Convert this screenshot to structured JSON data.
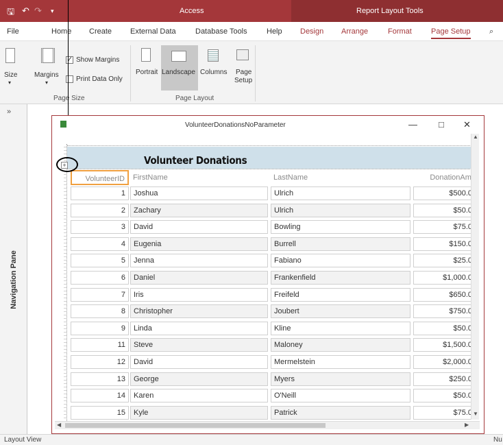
{
  "titlebar": {
    "app_title": "Access",
    "context_title": "Report Layout Tools"
  },
  "tabs": [
    {
      "label": "File",
      "context": false,
      "active": false
    },
    {
      "label": "Home",
      "context": false,
      "active": false
    },
    {
      "label": "Create",
      "context": false,
      "active": false
    },
    {
      "label": "External Data",
      "context": false,
      "active": false
    },
    {
      "label": "Database Tools",
      "context": false,
      "active": false
    },
    {
      "label": "Help",
      "context": false,
      "active": false
    },
    {
      "label": "Design",
      "context": true,
      "active": false
    },
    {
      "label": "Arrange",
      "context": true,
      "active": false
    },
    {
      "label": "Format",
      "context": true,
      "active": false
    },
    {
      "label": "Page Setup",
      "context": true,
      "active": true
    }
  ],
  "ribbon": {
    "size_label": "Size",
    "margins_label": "Margins",
    "show_margins_label": "Show Margins",
    "show_margins_checked": true,
    "print_data_only_label": "Print Data Only",
    "print_data_only_checked": false,
    "page_size_group": "Page Size",
    "portrait_label": "Portrait",
    "landscape_label": "Landscape",
    "columns_label": "Columns",
    "page_setup_label_1": "Page",
    "page_setup_label_2": "Setup",
    "page_layout_group": "Page Layout"
  },
  "nav_pane": {
    "chevron": "»",
    "label": "Navigation Pane"
  },
  "document": {
    "caption": "VolunteerDonationsNoParameter",
    "report_title": "Volunteer Donations",
    "columns": [
      "VolunteerID",
      "FirstName",
      "LastName",
      "DonationAmo"
    ],
    "rows": [
      {
        "id": "1",
        "first": "Joshua",
        "last": "Ulrich",
        "amount": "$500.0"
      },
      {
        "id": "2",
        "first": "Zachary",
        "last": "Ulrich",
        "amount": "$50.0"
      },
      {
        "id": "3",
        "first": "David",
        "last": "Bowling",
        "amount": "$75.0"
      },
      {
        "id": "4",
        "first": "Eugenia",
        "last": "Burrell",
        "amount": "$150.0"
      },
      {
        "id": "5",
        "first": "Jenna",
        "last": "Fabiano",
        "amount": "$25.0"
      },
      {
        "id": "6",
        "first": "Daniel",
        "last": "Frankenfield",
        "amount": "$1,000.0"
      },
      {
        "id": "7",
        "first": "Iris",
        "last": "Freifeld",
        "amount": "$650.0"
      },
      {
        "id": "8",
        "first": "Christopher",
        "last": "Joubert",
        "amount": "$750.0"
      },
      {
        "id": "9",
        "first": "Linda",
        "last": "Kline",
        "amount": "$50.0"
      },
      {
        "id": "11",
        "first": "Steve",
        "last": "Maloney",
        "amount": "$1,500.0"
      },
      {
        "id": "12",
        "first": "David",
        "last": "Mermelstein",
        "amount": "$2,000.0"
      },
      {
        "id": "13",
        "first": "George",
        "last": "Myers",
        "amount": "$250.0"
      },
      {
        "id": "14",
        "first": "Karen",
        "last": "O'Neill",
        "amount": "$50.0"
      },
      {
        "id": "15",
        "first": "Kyle",
        "last": "Patrick",
        "amount": "$75.0"
      }
    ]
  },
  "statusbar": {
    "left": "Layout View",
    "right": "Nu"
  },
  "colors": {
    "accent": "#a4373a",
    "header_band": "#cfe0ea",
    "selection": "#f0a040"
  }
}
